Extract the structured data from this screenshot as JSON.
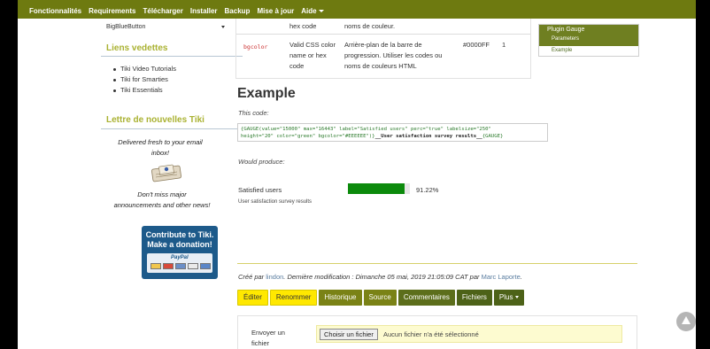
{
  "nav": {
    "items": [
      "Fonctionnalités",
      "Requirements",
      "Télécharger",
      "Installer",
      "Backup",
      "Mise à jour",
      "Aide"
    ]
  },
  "sidebar": {
    "dropdown_value": "BigBlueButton",
    "featured_heading": "Liens vedettes",
    "featured_links": [
      "Tiki Video Tutorials",
      "Tiki for Smarties",
      "Tiki Essentials"
    ],
    "newsletter_heading": "Lettre de nouvelles Tiki",
    "newsletter_text": "Delivered fresh to your email inbox!",
    "newsletter_more": "Don't miss major announcements and other news!",
    "donate": {
      "line1": "Contribute to Tiki.",
      "line2": "Make a donation!",
      "paypal": "PayPal"
    }
  },
  "params_table": {
    "prev_row": {
      "type_text": "hex code",
      "desc_text": "noms de couleur."
    },
    "row": {
      "name": "bgcolor",
      "type": "Valid CSS color name or hex code",
      "description": "Arrière-plan de la barre de progression. Utiliser les codes ou noms de couleurs HTML",
      "default": "#0000FF",
      "since": "1"
    }
  },
  "toc_box": {
    "title": "Plugin Gauge",
    "items": [
      "Parameters",
      "Example"
    ]
  },
  "example": {
    "heading": "Example",
    "this_code_label": "This code:",
    "code_line1": "{GAUGE(value=\"15000\" max=\"16443\" label=\"Satisfied users\" perc=\"true\" labelsize=\"250\"",
    "code_line2": "height=\"20\" color=\"green\" bgcolor=\"#EEEEEE\")}",
    "code_bold": "__User satisfaction survey results__",
    "code_end": "{GAUGE}",
    "would_produce_label": "Would produce:",
    "gauge": {
      "label": "Satisfied users",
      "value": 15000,
      "max": 16443,
      "percent_text": "91.22%",
      "fill_color": "#0c8a0c",
      "caption": "User satisfaction survey results"
    }
  },
  "meta": {
    "created_prefix": "Créé par ",
    "creator": "lindon",
    "modified_prefix": ". Dernière modification : Dimanche 05 mai, 2019 21:05:09 CAT par ",
    "modifier": "Marc Laporte",
    "suffix": "."
  },
  "actions": {
    "edit": "Éditer",
    "rename": "Renommer",
    "history": "Historique",
    "source": "Source",
    "comments": "Commentaires",
    "files": "Fichiers",
    "more": "Plus"
  },
  "upload": {
    "label": "Envoyer un fichier",
    "button": "Choisir un fichier",
    "status": "Aucun fichier n'a été sélectionné"
  }
}
